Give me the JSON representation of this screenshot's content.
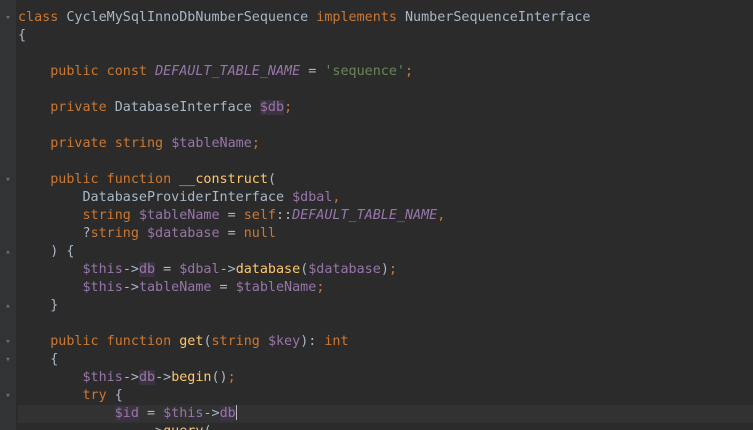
{
  "editor": {
    "lines": [
      {
        "fold": "▾",
        "tokens": [
          {
            "t": "class",
            "c": "#cc7832"
          },
          {
            "t": " ",
            "c": "#a9b7c6"
          },
          {
            "t": "CycleMySqlInnoDbNumberSequence",
            "c": "#a9b7c6"
          },
          {
            "t": " ",
            "c": "#a9b7c6"
          },
          {
            "t": "implements",
            "c": "#cc7832"
          },
          {
            "t": " ",
            "c": "#a9b7c6"
          },
          {
            "t": "NumberSequenceInterface",
            "c": "#a9b7c6"
          }
        ]
      },
      {
        "tokens": [
          {
            "t": "{",
            "c": "#a9b7c6"
          }
        ]
      },
      {
        "tokens": []
      },
      {
        "tokens": [
          {
            "t": "    ",
            "c": "#a9b7c6"
          },
          {
            "t": "public const",
            "c": "#cc7832"
          },
          {
            "t": " ",
            "c": "#a9b7c6"
          },
          {
            "t": "DEFAULT_TABLE_NAME",
            "c": "#9876aa",
            "i": true
          },
          {
            "t": " = ",
            "c": "#a9b7c6"
          },
          {
            "t": "'sequence'",
            "c": "#6a8759"
          },
          {
            "t": ";",
            "c": "#cc7832"
          }
        ]
      },
      {
        "tokens": []
      },
      {
        "tokens": [
          {
            "t": "    ",
            "c": "#a9b7c6"
          },
          {
            "t": "private",
            "c": "#cc7832"
          },
          {
            "t": " DatabaseInterface ",
            "c": "#a9b7c6"
          },
          {
            "t": "$db",
            "c": "#9876aa",
            "bg": "#3b3340"
          },
          {
            "t": ";",
            "c": "#cc7832"
          }
        ]
      },
      {
        "tokens": []
      },
      {
        "tokens": [
          {
            "t": "    ",
            "c": "#a9b7c6"
          },
          {
            "t": "private",
            "c": "#cc7832"
          },
          {
            "t": " ",
            "c": "#a9b7c6"
          },
          {
            "t": "string",
            "c": "#cc7832"
          },
          {
            "t": " ",
            "c": "#a9b7c6"
          },
          {
            "t": "$tableName",
            "c": "#9876aa"
          },
          {
            "t": ";",
            "c": "#cc7832"
          }
        ]
      },
      {
        "tokens": []
      },
      {
        "fold": "▾",
        "tokens": [
          {
            "t": "    ",
            "c": "#a9b7c6"
          },
          {
            "t": "public function",
            "c": "#cc7832"
          },
          {
            "t": " ",
            "c": "#a9b7c6"
          },
          {
            "t": "__construct",
            "c": "#ffc66d"
          },
          {
            "t": "(",
            "c": "#a9b7c6"
          }
        ]
      },
      {
        "tokens": [
          {
            "t": "        DatabaseProviderInterface ",
            "c": "#a9b7c6"
          },
          {
            "t": "$dbal",
            "c": "#9876aa"
          },
          {
            "t": ",",
            "c": "#cc7832"
          }
        ]
      },
      {
        "tokens": [
          {
            "t": "        ",
            "c": "#a9b7c6"
          },
          {
            "t": "string",
            "c": "#cc7832"
          },
          {
            "t": " ",
            "c": "#a9b7c6"
          },
          {
            "t": "$tableName",
            "c": "#9876aa"
          },
          {
            "t": " = ",
            "c": "#a9b7c6"
          },
          {
            "t": "self",
            "c": "#cc7832"
          },
          {
            "t": "::",
            "c": "#a9b7c6"
          },
          {
            "t": "DEFAULT_TABLE_NAME",
            "c": "#9876aa",
            "i": true
          },
          {
            "t": ",",
            "c": "#cc7832"
          }
        ]
      },
      {
        "tokens": [
          {
            "t": "        ?",
            "c": "#a9b7c6"
          },
          {
            "t": "string",
            "c": "#cc7832"
          },
          {
            "t": " ",
            "c": "#a9b7c6"
          },
          {
            "t": "$database",
            "c": "#9876aa"
          },
          {
            "t": " = ",
            "c": "#a9b7c6"
          },
          {
            "t": "null",
            "c": "#cc7832"
          }
        ]
      },
      {
        "fold": "▴",
        "tokens": [
          {
            "t": "    ) {",
            "c": "#a9b7c6"
          }
        ]
      },
      {
        "tokens": [
          {
            "t": "        ",
            "c": "#a9b7c6"
          },
          {
            "t": "$this",
            "c": "#9876aa"
          },
          {
            "t": "->",
            "c": "#a9b7c6"
          },
          {
            "t": "db",
            "c": "#9876aa",
            "bg": "#3b3340"
          },
          {
            "t": " = ",
            "c": "#a9b7c6"
          },
          {
            "t": "$dbal",
            "c": "#9876aa"
          },
          {
            "t": "->",
            "c": "#a9b7c6"
          },
          {
            "t": "database",
            "c": "#ffc66d"
          },
          {
            "t": "(",
            "c": "#a9b7c6"
          },
          {
            "t": "$database",
            "c": "#9876aa"
          },
          {
            "t": ")",
            "c": "#a9b7c6"
          },
          {
            "t": ";",
            "c": "#cc7832"
          }
        ]
      },
      {
        "tokens": [
          {
            "t": "        ",
            "c": "#a9b7c6"
          },
          {
            "t": "$this",
            "c": "#9876aa"
          },
          {
            "t": "->",
            "c": "#a9b7c6"
          },
          {
            "t": "tableName",
            "c": "#9876aa"
          },
          {
            "t": " = ",
            "c": "#a9b7c6"
          },
          {
            "t": "$tableName",
            "c": "#9876aa"
          },
          {
            "t": ";",
            "c": "#cc7832"
          }
        ]
      },
      {
        "fold": "▴",
        "tokens": [
          {
            "t": "    }",
            "c": "#a9b7c6"
          }
        ]
      },
      {
        "tokens": []
      },
      {
        "fold": "▾",
        "tokens": [
          {
            "t": "    ",
            "c": "#a9b7c6"
          },
          {
            "t": "public function",
            "c": "#cc7832"
          },
          {
            "t": " ",
            "c": "#a9b7c6"
          },
          {
            "t": "get",
            "c": "#ffc66d"
          },
          {
            "t": "(",
            "c": "#a9b7c6"
          },
          {
            "t": "string",
            "c": "#cc7832"
          },
          {
            "t": " ",
            "c": "#a9b7c6"
          },
          {
            "t": "$key",
            "c": "#9876aa"
          },
          {
            "t": "): ",
            "c": "#a9b7c6"
          },
          {
            "t": "int",
            "c": "#cc7832"
          }
        ]
      },
      {
        "fold": "▾",
        "tokens": [
          {
            "t": "    {",
            "c": "#a9b7c6"
          }
        ]
      },
      {
        "tokens": [
          {
            "t": "        ",
            "c": "#a9b7c6"
          },
          {
            "t": "$this",
            "c": "#9876aa"
          },
          {
            "t": "->",
            "c": "#a9b7c6"
          },
          {
            "t": "db",
            "c": "#9876aa",
            "bg": "#3b3340"
          },
          {
            "t": "->",
            "c": "#a9b7c6"
          },
          {
            "t": "begin",
            "c": "#ffc66d"
          },
          {
            "t": "()",
            "c": "#a9b7c6"
          },
          {
            "t": ";",
            "c": "#cc7832"
          }
        ]
      },
      {
        "fold": "▾",
        "tokens": [
          {
            "t": "        ",
            "c": "#a9b7c6"
          },
          {
            "t": "try",
            "c": "#cc7832"
          },
          {
            "t": " {",
            "c": "#a9b7c6"
          }
        ]
      },
      {
        "current": true,
        "caret": true,
        "tokens": [
          {
            "t": "            ",
            "c": "#a9b7c6"
          },
          {
            "t": "$id",
            "c": "#9876aa",
            "bg": "#3b3340"
          },
          {
            "t": " = ",
            "c": "#a9b7c6"
          },
          {
            "t": "$this",
            "c": "#9876aa"
          },
          {
            "t": "->",
            "c": "#a9b7c6"
          },
          {
            "t": "db",
            "c": "#9876aa",
            "bg": "#3b3340"
          }
        ]
      },
      {
        "tokens": [
          {
            "t": "                ->",
            "c": "#a9b7c6"
          },
          {
            "t": "query",
            "c": "#ffc66d"
          },
          {
            "t": "(",
            "c": "#a9b7c6"
          }
        ]
      }
    ]
  }
}
